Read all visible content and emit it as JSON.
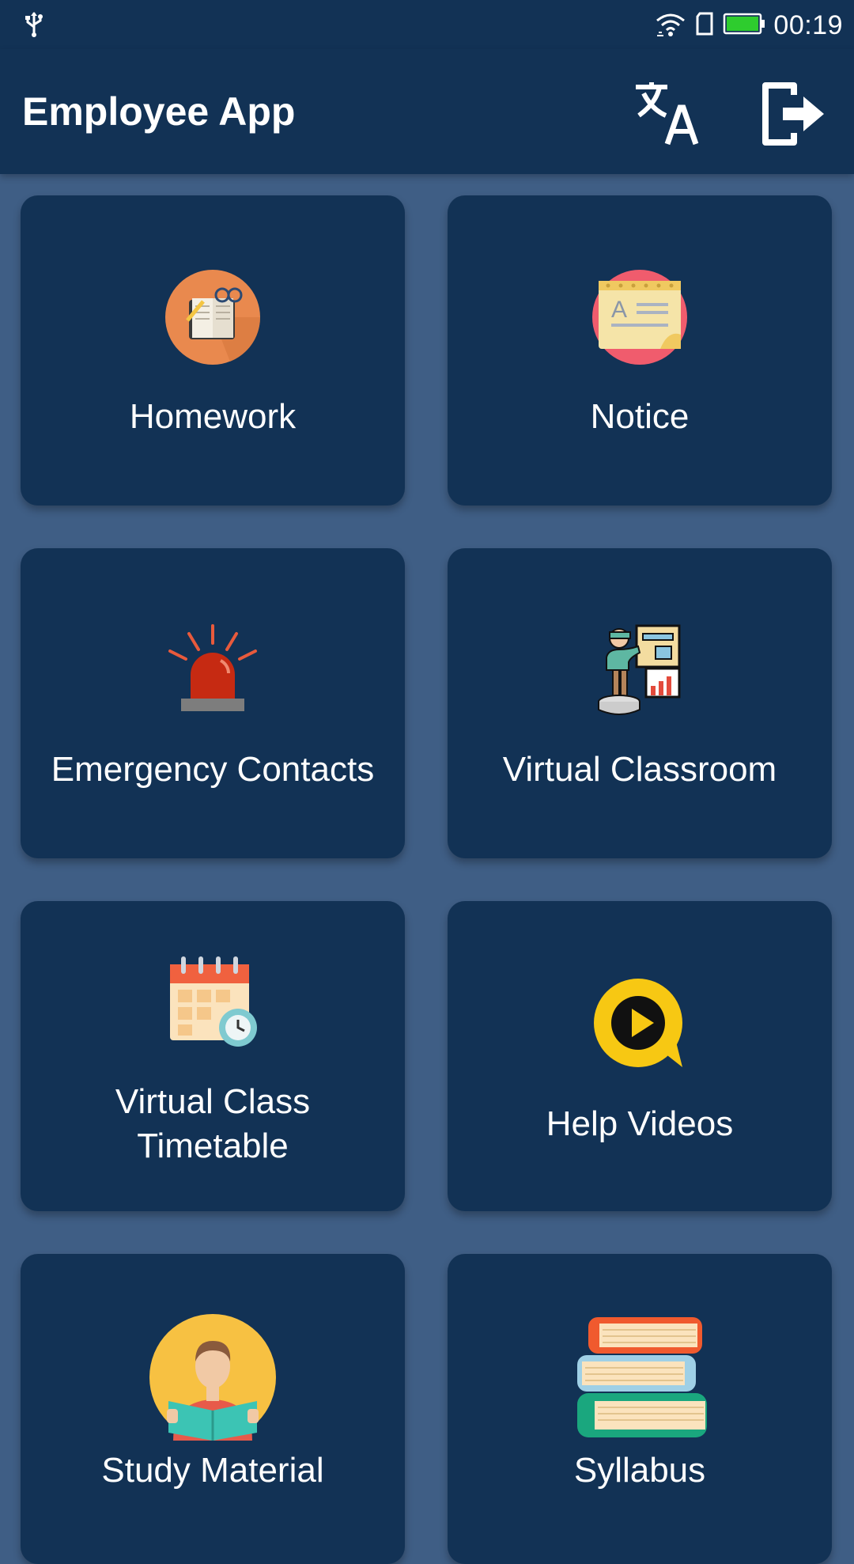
{
  "status_bar": {
    "time": "00:19"
  },
  "app_bar": {
    "title": "Employee App"
  },
  "tiles": [
    {
      "label": "Homework",
      "icon": "notebook-icon"
    },
    {
      "label": "Notice",
      "icon": "notice-pad-icon"
    },
    {
      "label": "Emergency Contacts",
      "icon": "siren-icon"
    },
    {
      "label": "Virtual Classroom",
      "icon": "teacher-board-icon"
    },
    {
      "label_line1": "Virtual Class",
      "label_line2": "Timetable",
      "icon": "calendar-clock-icon"
    },
    {
      "label": "Help Videos",
      "icon": "play-bubble-icon"
    },
    {
      "label": "Study Material",
      "icon": "reading-person-icon"
    },
    {
      "label": "Syllabus",
      "icon": "book-stack-icon"
    }
  ],
  "colors": {
    "app_bar": "#123255",
    "background": "#3f5e85",
    "tile": "#123255",
    "battery": "#2ecc2e"
  }
}
